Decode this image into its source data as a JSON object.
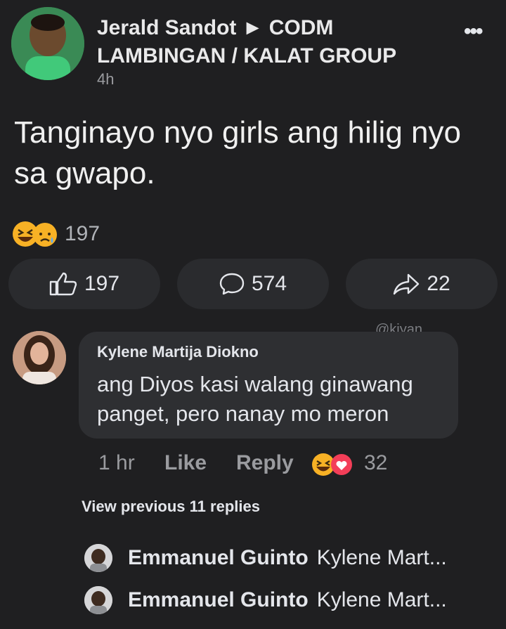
{
  "post": {
    "author": "Jerald Sandot ► CODM LAMBINGAN / KALAT GROUP",
    "time": "4h",
    "text": "Tanginayo nyo girls ang hilig nyo sa gwapo.",
    "reaction_count": "197",
    "like_count": "197",
    "comment_count": "574",
    "share_count": "22"
  },
  "watermark": "@kiyan",
  "comment": {
    "author": "Kylene Martija Diokno",
    "text": "ang Diyos kasi walang ginawang panget, pero nanay mo meron",
    "time": "1 hr",
    "like_label": "Like",
    "reply_label": "Reply",
    "reaction_count": "32"
  },
  "view_previous": "View previous 11 replies",
  "replies": [
    {
      "author": "Emmanuel Guinto",
      "text": "Kylene Mart..."
    },
    {
      "author": "Emmanuel Guinto",
      "text": "Kylene Mart..."
    }
  ],
  "colors": {
    "background": "#1f1f21",
    "button": "#2a2b2e",
    "bubble": "#2e2f32",
    "muted": "#9a9b9f",
    "haha": "#f7b125",
    "love": "#f33e58"
  }
}
